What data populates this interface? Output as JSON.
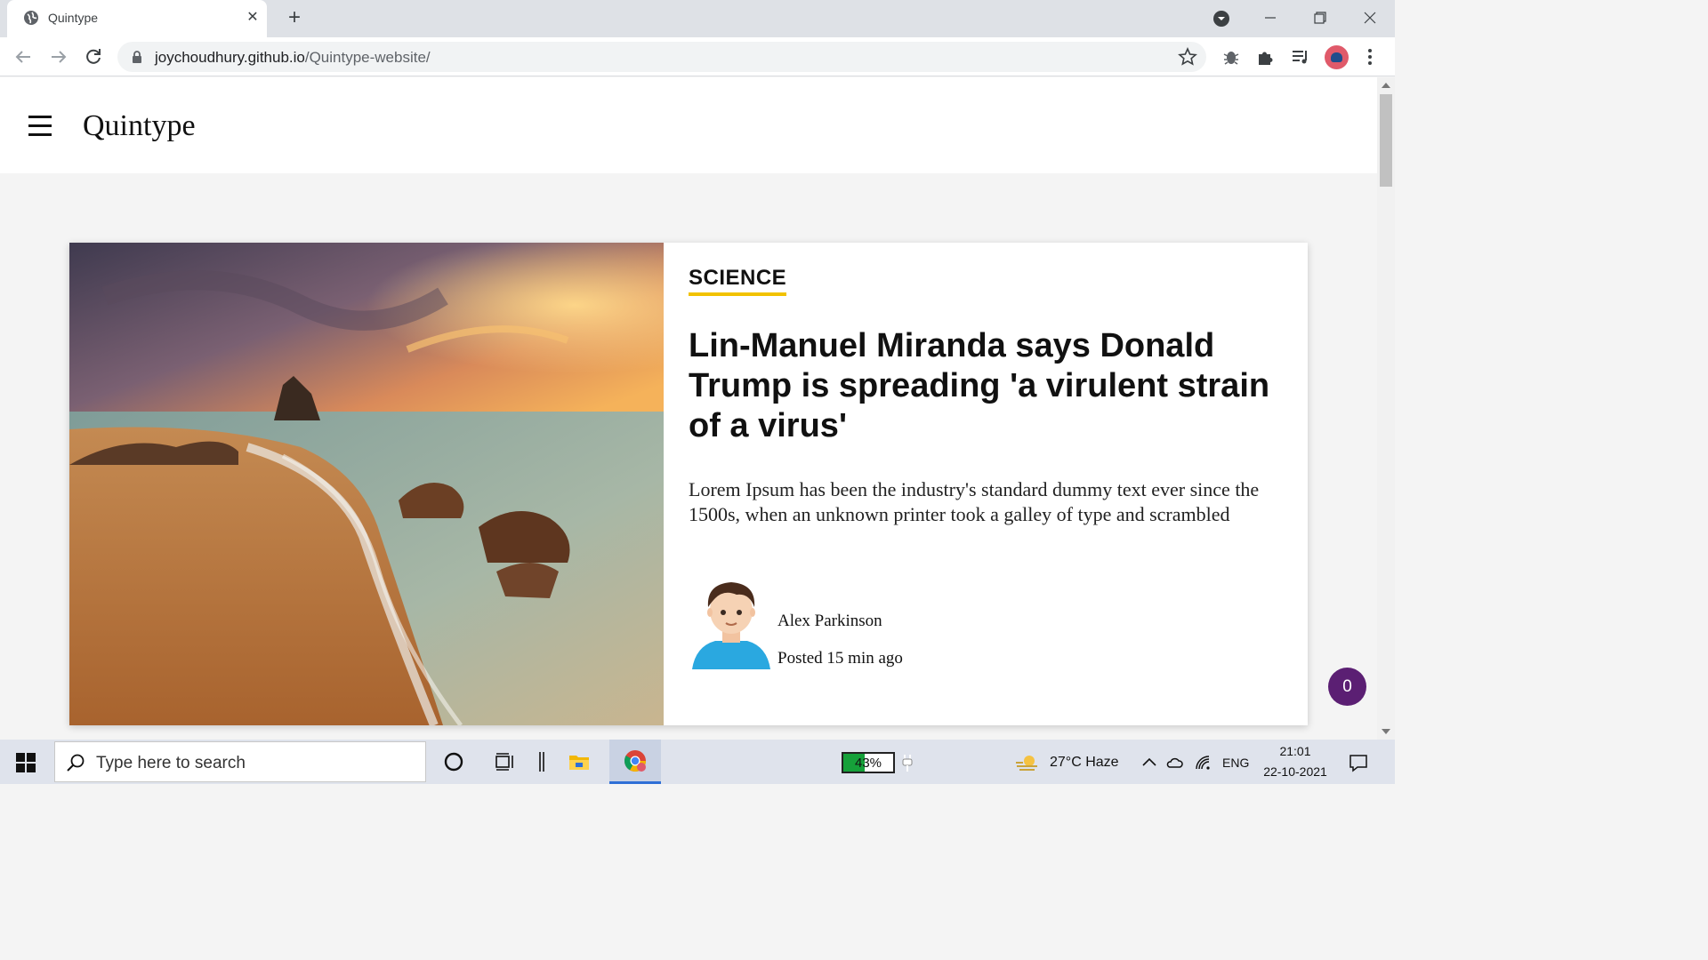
{
  "browser": {
    "tab_title": "Quintype",
    "url_host": "joychoudhury.github.io",
    "url_path": "/Quintype-website/"
  },
  "site": {
    "brand": "Quintype"
  },
  "article": {
    "category": "SCIENCE",
    "category_underline_color": "#f2c200",
    "headline": "Lin-Manuel Miranda says Donald Trump is spreading 'a virulent strain of a virus'",
    "excerpt": "Lorem Ipsum has been the industry's standard dummy text ever since the 1500s, when an unknown printer took a galley of type and scrambled",
    "author": "Alex Parkinson",
    "posted": "Posted 15 min ago"
  },
  "fab": {
    "count": "0",
    "color": "#5b1f73"
  },
  "taskbar": {
    "search_placeholder": "Type here to search",
    "battery_text": "43%",
    "battery_level": 0.43,
    "weather": "27°C  Haze",
    "language": "ENG",
    "time": "21:01",
    "date": "22-10-2021"
  }
}
